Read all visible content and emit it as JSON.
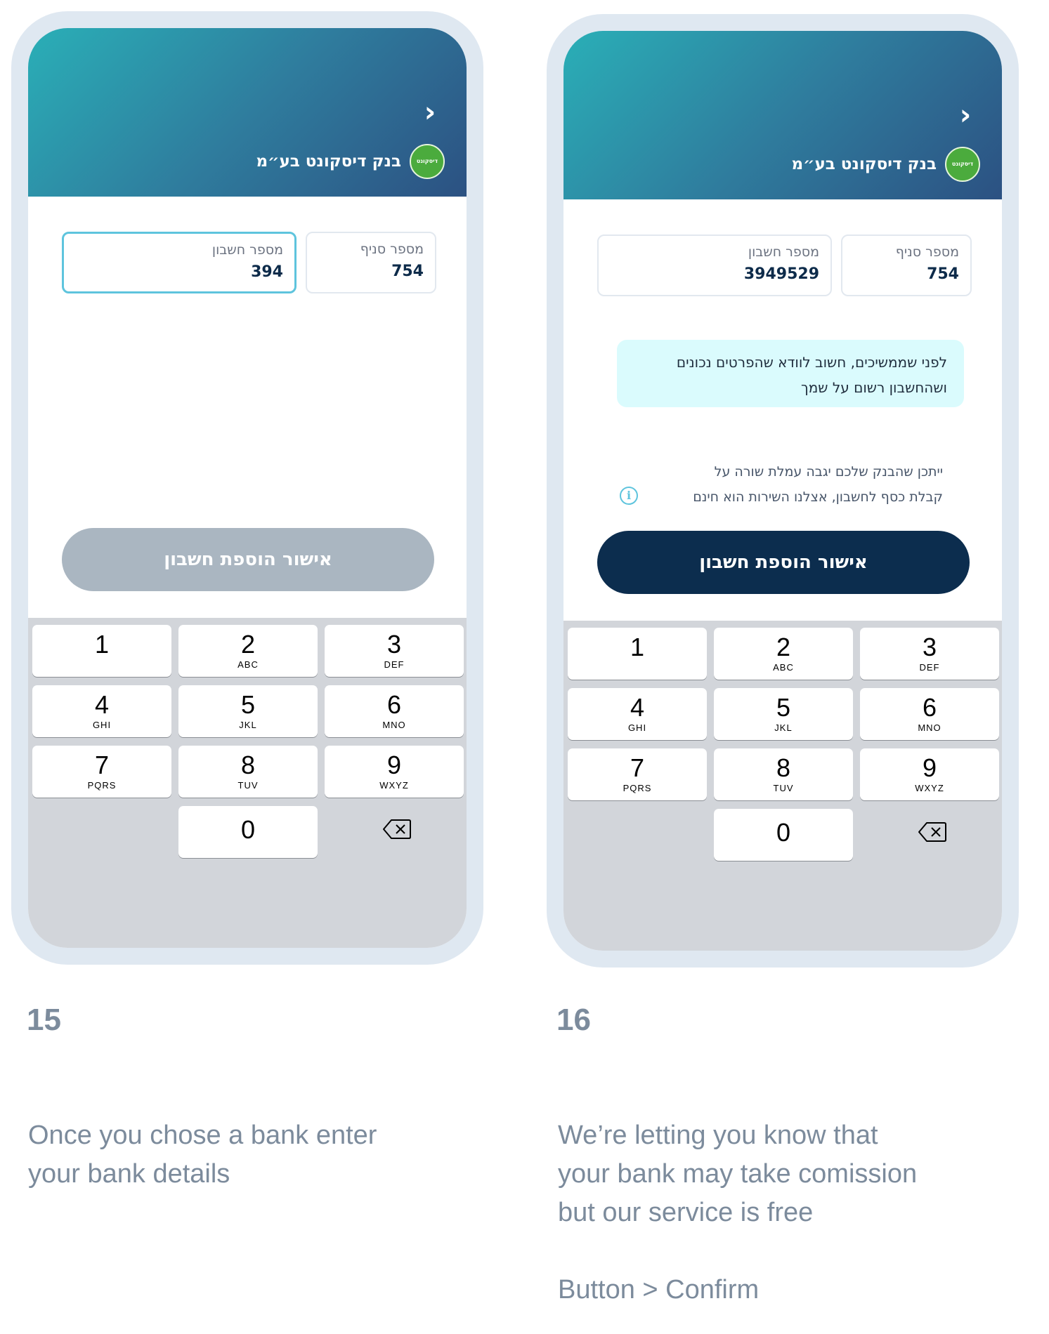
{
  "screens": [
    {
      "step_number": "15",
      "bank_logo_text": "דיסקונט",
      "bank_name": "בנק דיסקונט בע״מ",
      "branch_field": {
        "label": "מספר סניף",
        "value": "754"
      },
      "account_field": {
        "label": "מספר חשבון",
        "value": "394",
        "focused": true
      },
      "confirm_button": {
        "label": "אישור הוספת חשבון",
        "state": "disabled",
        "color": "#aab6c1"
      },
      "caption_lines": [
        "Once you chose a bank enter",
        "your bank details"
      ]
    },
    {
      "step_number": "16",
      "bank_logo_text": "דיסקונט",
      "bank_name": "בנק דיסקונט בע״מ",
      "branch_field": {
        "label": "מספר סניף",
        "value": "754"
      },
      "account_field": {
        "label": "מספר חשבון",
        "value": "3949529",
        "focused": false
      },
      "notice_lines": [
        "לפני שממשיכים, חשוב לוודא שהפרטים נכונים",
        "ושהחשבון רשום על שמך"
      ],
      "info_lines": [
        "ייתכן שהבנק שלכם יגבה עמלת שורה על",
        "קבלת כסף לחשבון, אצלנו השירות הוא חינם"
      ],
      "confirm_button": {
        "label": "אישור הוספת חשבון",
        "state": "enabled",
        "color": "#0c2d4e"
      },
      "caption_lines": [
        "We’re letting you know that",
        "your bank may take comission",
        "but our service is free"
      ],
      "caption_extra": "Button > Confirm"
    }
  ],
  "keypad": [
    {
      "digit": "1",
      "letters": ""
    },
    {
      "digit": "2",
      "letters": "ABC"
    },
    {
      "digit": "3",
      "letters": "DEF"
    },
    {
      "digit": "4",
      "letters": "GHI"
    },
    {
      "digit": "5",
      "letters": "JKL"
    },
    {
      "digit": "6",
      "letters": "MNO"
    },
    {
      "digit": "7",
      "letters": "PQRS"
    },
    {
      "digit": "8",
      "letters": "TUV"
    },
    {
      "digit": "9",
      "letters": "WXYZ"
    },
    {
      "digit": "0",
      "letters": ""
    }
  ],
  "icons": {
    "back": "chevron-right-icon",
    "delete": "backspace-icon",
    "info": "info-icon",
    "bank": "bank-logo-icon"
  },
  "colors": {
    "header_start": "#2aafb7",
    "header_end": "#2c5182",
    "focus_border": "#5ec4dd",
    "notice_bg": "#dafbfd",
    "caption": "#7c8b9c"
  }
}
